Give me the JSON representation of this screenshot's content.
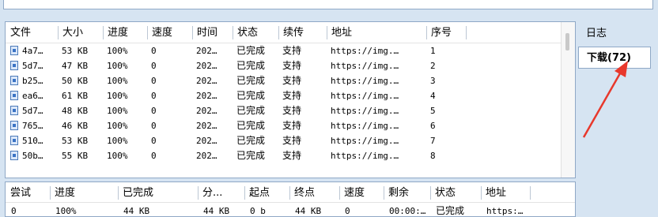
{
  "top_columns": [
    {
      "label": "文件",
      "w": 66
    },
    {
      "label": "大小",
      "w": 57
    },
    {
      "label": "进度",
      "w": 56
    },
    {
      "label": "速度",
      "w": 57
    },
    {
      "label": "时间",
      "w": 51
    },
    {
      "label": "状态",
      "w": 58
    },
    {
      "label": "续传",
      "w": 61
    },
    {
      "label": "地址",
      "w": 126
    },
    {
      "label": "序号",
      "w": 50
    }
  ],
  "top_rows": [
    {
      "file": "4a7…",
      "size": "53 KB",
      "progress": "100%",
      "speed": "0",
      "time": "202…",
      "status": "已完成",
      "resume": "支持",
      "url": "https://img.…",
      "index": "1"
    },
    {
      "file": "5d7…",
      "size": "47 KB",
      "progress": "100%",
      "speed": "0",
      "time": "202…",
      "status": "已完成",
      "resume": "支持",
      "url": "https://img.…",
      "index": "2"
    },
    {
      "file": "b25…",
      "size": "50 KB",
      "progress": "100%",
      "speed": "0",
      "time": "202…",
      "status": "已完成",
      "resume": "支持",
      "url": "https://img.…",
      "index": "3"
    },
    {
      "file": "ea6…",
      "size": "61 KB",
      "progress": "100%",
      "speed": "0",
      "time": "202…",
      "status": "已完成",
      "resume": "支持",
      "url": "https://img.…",
      "index": "4"
    },
    {
      "file": "5d7…",
      "size": "48 KB",
      "progress": "100%",
      "speed": "0",
      "time": "202…",
      "status": "已完成",
      "resume": "支持",
      "url": "https://img.…",
      "index": "5"
    },
    {
      "file": "765…",
      "size": "46 KB",
      "progress": "100%",
      "speed": "0",
      "time": "202…",
      "status": "已完成",
      "resume": "支持",
      "url": "https://img.…",
      "index": "6"
    },
    {
      "file": "510…",
      "size": "53 KB",
      "progress": "100%",
      "speed": "0",
      "time": "202…",
      "status": "已完成",
      "resume": "支持",
      "url": "https://img.…",
      "index": "7"
    },
    {
      "file": "50b…",
      "size": "55 KB",
      "progress": "100%",
      "speed": "0",
      "time": "202…",
      "status": "已完成",
      "resume": "支持",
      "url": "https://img.…",
      "index": "8"
    }
  ],
  "bottom_columns": [
    {
      "label": "尝试",
      "w": 56
    },
    {
      "label": "进度",
      "w": 86
    },
    {
      "label": "已完成",
      "w": 101
    },
    {
      "label": "分...",
      "w": 59
    },
    {
      "label": "起点",
      "w": 57
    },
    {
      "label": "终点",
      "w": 63
    },
    {
      "label": "速度",
      "w": 56
    },
    {
      "label": "剩余",
      "w": 59
    },
    {
      "label": "状态",
      "w": 64
    },
    {
      "label": "地址",
      "w": 62
    }
  ],
  "bottom_row": [
    "0",
    "100%",
    "44 KB",
    "44 KB",
    "0 b",
    "44 KB",
    "0",
    "00:00:…",
    "已完成",
    "https:…"
  ],
  "sidebar": {
    "tabs": [
      "日志",
      "下载(72)"
    ],
    "active_index": 1
  },
  "colors": {
    "background": "#d6e4f2",
    "border": "#8fa8c6",
    "annotation_arrow": "#e8382c"
  }
}
